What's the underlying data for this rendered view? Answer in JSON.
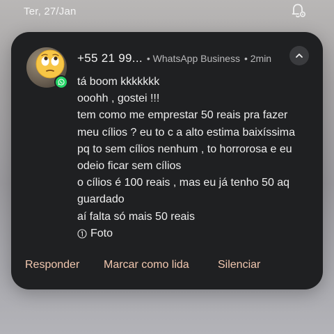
{
  "status_bar": {
    "date": "Ter, 27/Jan",
    "icon": "notification-settings-icon"
  },
  "notification": {
    "sender": "+55 21 99...",
    "app_name": "• WhatsApp Business",
    "time": "• 2min",
    "avatar_emoji": "face-with-rolling-eyes",
    "badge_icon": "whatsapp-icon",
    "collapse_icon": "chevron-up-icon",
    "messages": [
      "tá boom kkkkkkk",
      "ooohh , gostei !!!",
      "tem como me emprestar 50 reais pra fazer",
      "meu cílios ? eu to c a alto estima baixíssima",
      "pq to sem cílios nenhum , to horrorosa e eu",
      "odeio ficar sem cílios",
      "o cílios é 100 reais , mas eu já tenho 50 aq",
      "guardado",
      "aí falta só mais 50 reais"
    ],
    "photo_icon": "info-circle-icon",
    "photo_label": "Foto",
    "actions": {
      "reply": "Responder",
      "mark_read": "Marcar como lida",
      "mute": "Silenciar"
    },
    "colors": {
      "card_bg": "#1f2022",
      "action_text": "#f2c8b0",
      "whatsapp_green": "#25d366"
    }
  }
}
